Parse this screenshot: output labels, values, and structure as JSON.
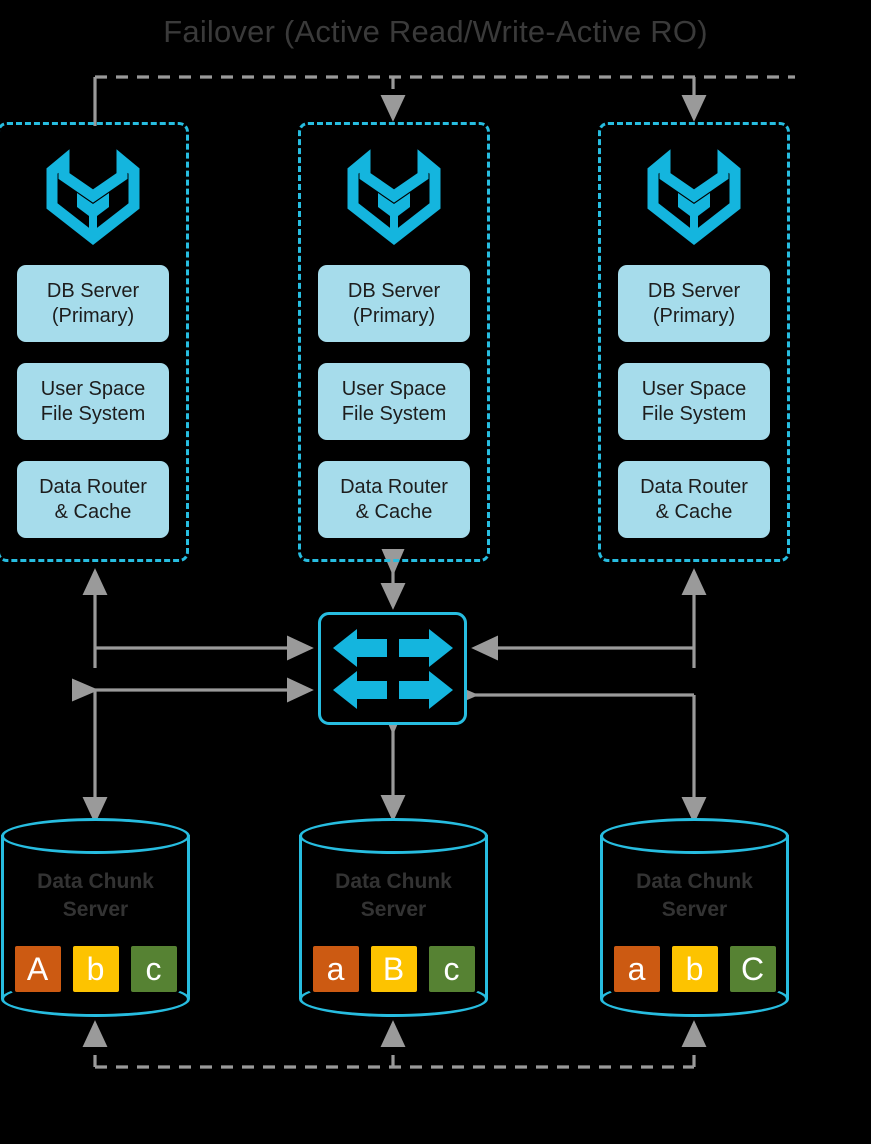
{
  "title": "Failover (Active Read/Write-Active RO)",
  "colors": {
    "background": "#000000",
    "accent_cyan": "#27bde0",
    "box_fill": "#a6dceb",
    "connector_gray": "#9a9a9a",
    "title_gray": "#3a3a3a",
    "chip_orange": "#cc5a12",
    "chip_yellow": "#fdc300",
    "chip_green": "#568233"
  },
  "db_panels": [
    {
      "logo_icon": "bear-box-logo-icon",
      "boxes": [
        {
          "line1": "DB Server",
          "line2": "(Primary)"
        },
        {
          "line1": "User Space",
          "line2": "File System"
        },
        {
          "line1": "Data Router",
          "line2": "& Cache"
        }
      ]
    },
    {
      "logo_icon": "bear-box-logo-icon",
      "boxes": [
        {
          "line1": "DB Server",
          "line2": "(Primary)"
        },
        {
          "line1": "User Space",
          "line2": "File System"
        },
        {
          "line1": "Data Router",
          "line2": "& Cache"
        }
      ]
    },
    {
      "logo_icon": "bear-box-logo-icon",
      "boxes": [
        {
          "line1": "DB Server",
          "line2": "(Primary)"
        },
        {
          "line1": "User Space",
          "line2": "File System"
        },
        {
          "line1": "Data Router",
          "line2": "& Cache"
        }
      ]
    }
  ],
  "switch": {
    "icon": "network-switch-arrows-icon",
    "label": ""
  },
  "chunk_servers": [
    {
      "line1": "Data Chunk",
      "line2": "Server",
      "chips": [
        {
          "label": "A",
          "color": "#cc5a12"
        },
        {
          "label": "b",
          "color": "#fdc300"
        },
        {
          "label": "c",
          "color": "#568233"
        }
      ]
    },
    {
      "line1": "Data Chunk",
      "line2": "Server",
      "chips": [
        {
          "label": "a",
          "color": "#cc5a12"
        },
        {
          "label": "B",
          "color": "#fdc300"
        },
        {
          "label": "c",
          "color": "#568233"
        }
      ]
    },
    {
      "line1": "Data Chunk",
      "line2": "Server",
      "chips": [
        {
          "label": "a",
          "color": "#cc5a12"
        },
        {
          "label": "b",
          "color": "#fdc300"
        },
        {
          "label": "C",
          "color": "#568233"
        }
      ]
    }
  ]
}
